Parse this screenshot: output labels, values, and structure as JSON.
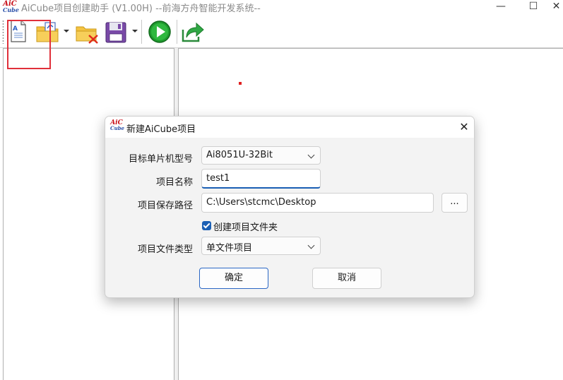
{
  "window": {
    "title": "AiCube项目创建助手 (V1.00H) --前海方舟智能开发系统--",
    "logo_top": "AiC",
    "logo_bottom": "Cube",
    "min_glyph": "—",
    "max_glyph": "☐",
    "close_glyph": "✕"
  },
  "dialog": {
    "title": "新建AiCube项目",
    "logo_top": "AiC",
    "logo_bottom": "Cube",
    "close_glyph": "✕",
    "mcu_label": "目标单片机型号",
    "mcu_value": "Ai8051U-32Bit",
    "name_label": "项目名称",
    "name_value": "test1",
    "path_label": "项目保存路径",
    "path_value": "C:\\Users\\stcmc\\Desktop",
    "browse_label": "...",
    "create_folder_label": "创建项目文件夹",
    "create_folder_checked": true,
    "filetype_label": "项目文件类型",
    "filetype_value": "单文件项目",
    "ok_label": "确定",
    "cancel_label": "取消"
  },
  "colors": {
    "accent": "#1a5fb4",
    "highlight": "#e0303a",
    "logo_red": "#c8101a",
    "logo_blue": "#2a4fa8"
  },
  "toolbar_icons": [
    "new-document-icon",
    "open-folder-icon",
    "delete-folder-icon",
    "save-icon",
    "run-icon",
    "export-icon"
  ]
}
